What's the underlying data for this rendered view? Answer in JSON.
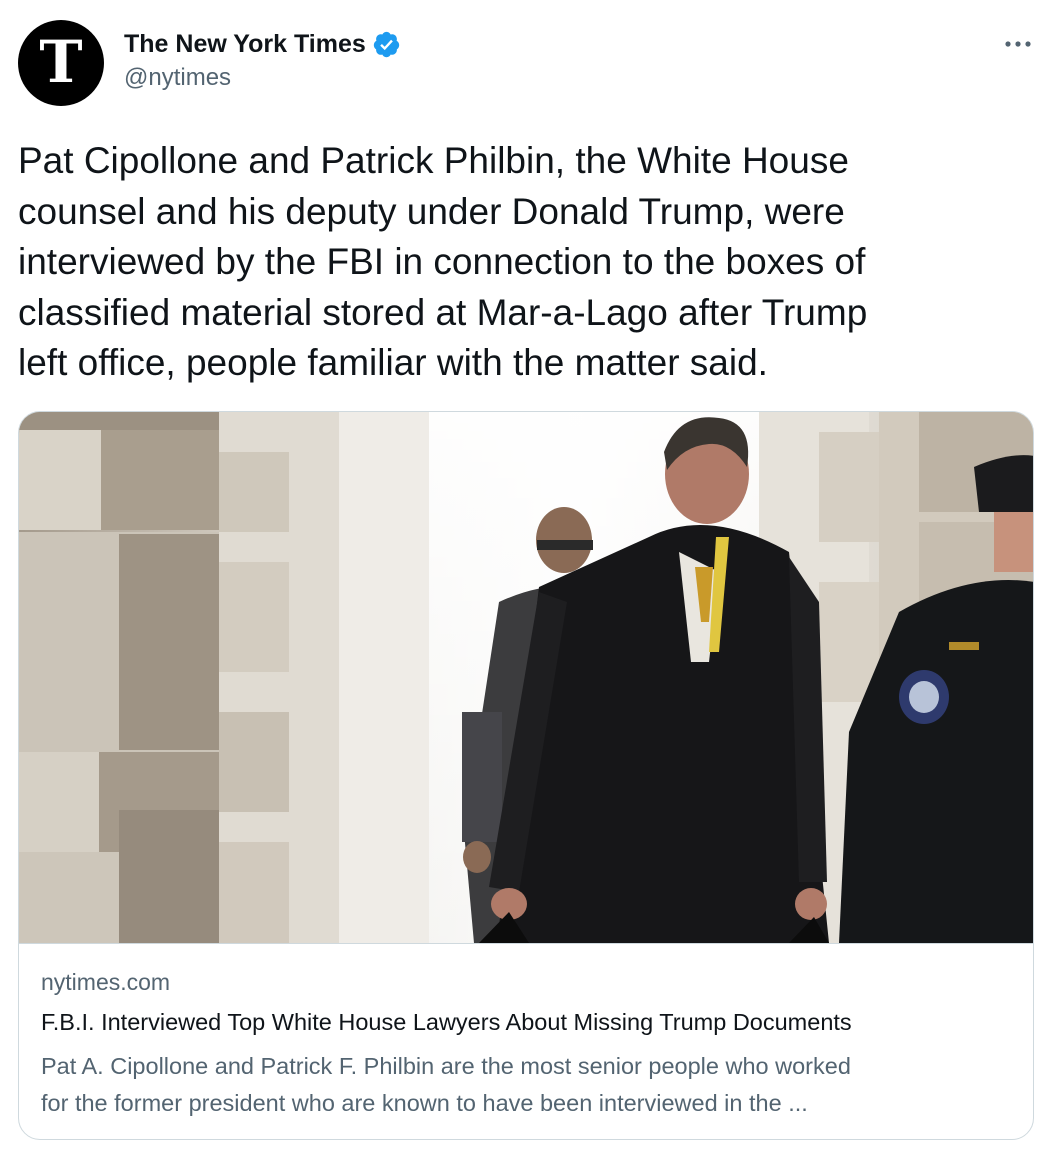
{
  "tweet": {
    "author": {
      "display_name": "The New York Times",
      "handle": "@nytimes",
      "verified": true,
      "avatar_glyph": "T",
      "avatar_icon": "nyt-logo-icon"
    },
    "more_icon": "more-horizontal-icon",
    "text_lines": [
      "Pat Cipollone and Patrick Philbin, the White House",
      "counsel and his deputy under Donald Trump, were",
      "interviewed by the FBI in connection to the boxes of",
      "classified material stored at Mar-a-Lago after Trump",
      "left office, people familiar with the matter said."
    ]
  },
  "link_card": {
    "domain": "nytimes.com",
    "title": "F.B.I. Interviewed Top White House Lawyers About Missing Trump Documents",
    "description_lines": [
      "Pat A. Cipollone and Patrick F. Philbin are the most senior people who worked",
      "for the former president who are known to have been interviewed in the ..."
    ]
  },
  "colors": {
    "text_primary": "#0f1419",
    "text_secondary": "#536471",
    "verified_blue": "#1d9bf0",
    "border": "#cfd9de"
  }
}
